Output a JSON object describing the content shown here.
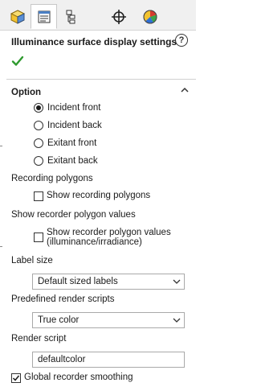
{
  "panel": {
    "title": "Illuminance surface display settings",
    "help_glyph": "?",
    "tabs": [
      {
        "icon": "feature-manager-icon"
      },
      {
        "icon": "property-manager-icon",
        "active": true
      },
      {
        "icon": "configuration-manager-icon"
      },
      {
        "icon": "dimxpert-icon"
      },
      {
        "icon": "display-manager-icon"
      }
    ]
  },
  "option": {
    "heading": "Option",
    "selected": "Incident front",
    "radios": [
      "Incident front",
      "Incident back",
      "Exitant front",
      "Exitant back"
    ]
  },
  "recording_polygons": {
    "heading": "Recording polygons",
    "checkbox_label": "Show recording polygons",
    "checked": false
  },
  "recorder_values": {
    "heading": "Show recorder polygon values",
    "checkbox_line1": "Show recorder polygon values",
    "checkbox_line2": "(illuminance/irradiance)",
    "checked": false
  },
  "label_size": {
    "heading": "Label size",
    "value": "Default sized labels"
  },
  "render_scripts": {
    "heading": "Predefined render scripts",
    "value": "True color"
  },
  "render_script": {
    "heading": "Render script",
    "value": "defaultcolor"
  },
  "smoothing": {
    "label": "Global recorder smoothing",
    "checked": true
  },
  "colors": {
    "ok_green": "#2e9a2e",
    "border": "#a9a9a9"
  }
}
